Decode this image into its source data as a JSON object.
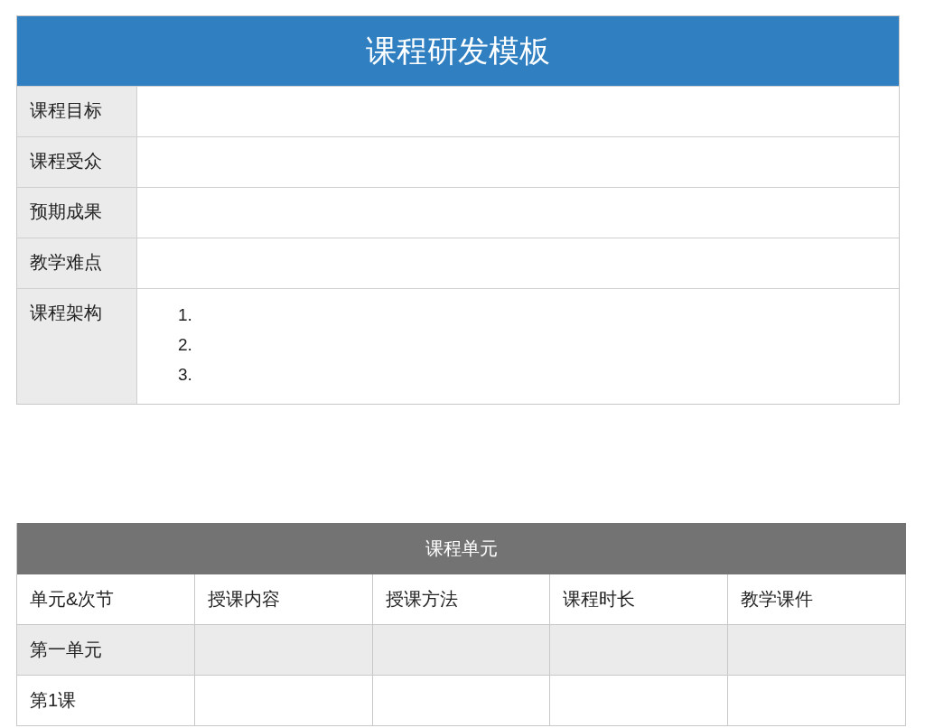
{
  "template": {
    "title": "课程研发模板",
    "rows": [
      {
        "label": "课程目标"
      },
      {
        "label": "课程受众"
      },
      {
        "label": "预期成果"
      },
      {
        "label": "教学难点"
      },
      {
        "label": "课程架构",
        "list": [
          "1.",
          "2.",
          "3."
        ]
      }
    ]
  },
  "units": {
    "title": "课程单元",
    "columns": [
      "单元&次节",
      "授课内容",
      "授课方法",
      "课程时长",
      "教学课件"
    ],
    "rows": [
      {
        "kind": "unit",
        "cells": [
          "第一单元",
          "",
          "",
          "",
          ""
        ]
      },
      {
        "kind": "lesson",
        "cells": [
          "第1课",
          "",
          "",
          "",
          ""
        ]
      }
    ]
  }
}
